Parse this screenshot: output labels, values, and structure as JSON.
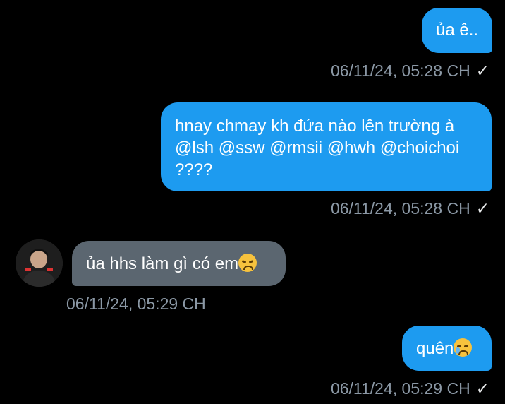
{
  "messages": [
    {
      "text": "ủa ê..",
      "time": "06/11/24, 05:28 CH",
      "direction": "outgoing"
    },
    {
      "lines": [
        "hnay chmay kh đứa nào lên trường à",
        "@lsh @ssw @rmsii @hwh @choichoi",
        "????"
      ],
      "time": "06/11/24, 05:28 CH",
      "direction": "outgoing"
    },
    {
      "text": "ủa hhs làm gì có em",
      "emoji": "disappointed-face",
      "time": "06/11/24, 05:29 CH",
      "direction": "incoming"
    },
    {
      "text": "quên",
      "emoji": "crying-face",
      "time": "06/11/24, 05:29 CH",
      "direction": "outgoing"
    }
  ],
  "status_icon": "✓",
  "colors": {
    "outgoing_bubble": "#1d9bf0",
    "incoming_bubble": "#5b6670",
    "timestamp": "#8b98a5",
    "background": "#000000"
  }
}
